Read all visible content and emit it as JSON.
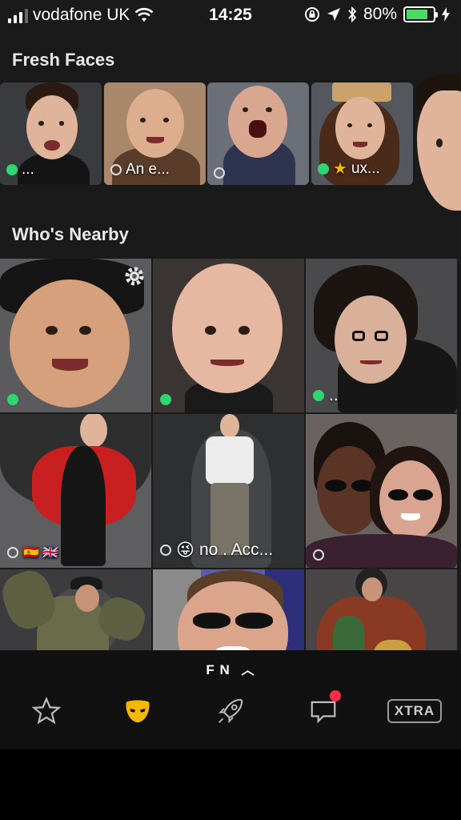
{
  "status_bar": {
    "carrier": "vodafone UK",
    "time": "14:25",
    "battery_percent": "80%",
    "battery_level": 0.8,
    "icons": [
      "signal-icon",
      "wifi-icon",
      "rotation-lock-icon",
      "location-icon",
      "bluetooth-icon",
      "battery-icon",
      "charging-icon"
    ]
  },
  "fresh_faces": {
    "title": "Fresh Faces",
    "cards": [
      {
        "label": "...",
        "online": true,
        "starred": false
      },
      {
        "label": "An e...",
        "online": false,
        "starred": false
      },
      {
        "label": "",
        "online": false,
        "starred": false
      },
      {
        "label": "ux...",
        "online": true,
        "starred": true
      },
      {
        "label": "",
        "online": false,
        "starred": false
      }
    ]
  },
  "nearby": {
    "title": "Who's Nearby",
    "profiles": [
      {
        "label": "",
        "online": true
      },
      {
        "label": "",
        "online": true
      },
      {
        "label": "..",
        "online": true
      },
      {
        "label": "",
        "online": false,
        "flags": "🇪🇸 🇬🇧"
      },
      {
        "label": "no . Acc...",
        "online": false,
        "emoji": "😜"
      },
      {
        "label": "",
        "online": false
      },
      {
        "label": "",
        "online": false
      },
      {
        "label": "",
        "online": false
      },
      {
        "label": "",
        "online": false
      }
    ]
  },
  "tab_bar": {
    "fresh_label": "F N",
    "tabs": [
      "favorites-star-icon",
      "grindr-mask-icon",
      "rocket-icon",
      "chat-icon"
    ],
    "xtra_label": "XTRA"
  },
  "colors": {
    "online": "#2ed573",
    "brand": "#f5b800",
    "background": "#1a1a1b",
    "notification": "#ff2d4a"
  }
}
